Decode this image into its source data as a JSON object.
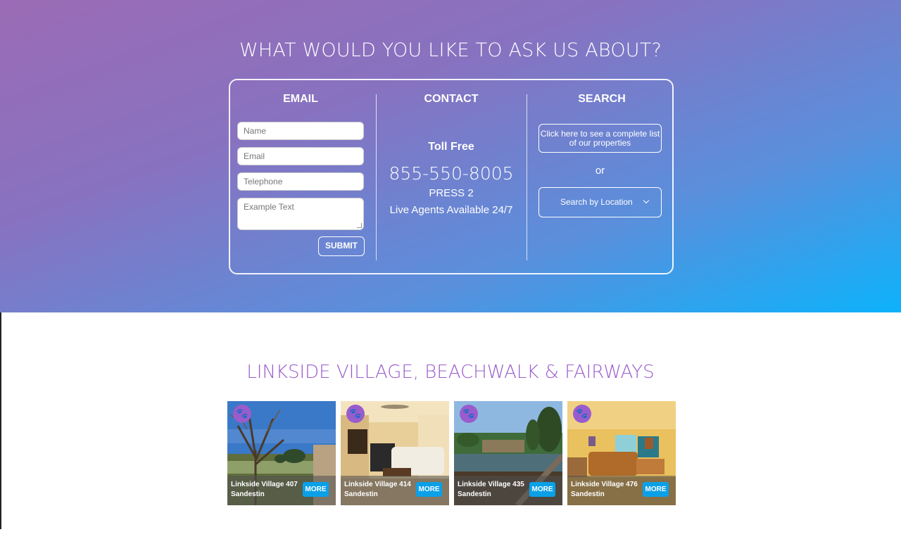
{
  "hero": {
    "title": "WHAT WOULD YOU LIKE TO ASK US ABOUT?"
  },
  "email": {
    "heading": "EMAIL",
    "name_placeholder": "Name",
    "email_placeholder": "Email",
    "telephone_placeholder": "Telephone",
    "message_placeholder": "Example Text",
    "submit_label": "SUBMIT"
  },
  "contact": {
    "heading": "CONTACT",
    "toll_free": "Toll Free",
    "phone": "855-550-8005",
    "press": "PRESS 2",
    "agents": "Live Agents Available 24/7"
  },
  "search": {
    "heading": "SEARCH",
    "properties_button": "Click here to see a complete list of our properties",
    "or": "or",
    "location_select": "Search by Location"
  },
  "listings": {
    "title": "LINKSIDE VILLAGE, BEACHWALK & FAIRWAYS",
    "more_label": "MORE",
    "items": [
      {
        "name": "Linkside Village 407",
        "location": "Sandestin"
      },
      {
        "name": "Linkside Village 414",
        "location": "Sandestin"
      },
      {
        "name": "Linkside Village 435",
        "location": "Sandestin"
      },
      {
        "name": "Linkside Village 476",
        "location": "Sandestin"
      }
    ]
  },
  "colors": {
    "accent_purple": "#9a5ccc",
    "more_button_blue": "#0aa0e8"
  },
  "icons": [
    "paw-icon",
    "chevron-down-icon"
  ]
}
